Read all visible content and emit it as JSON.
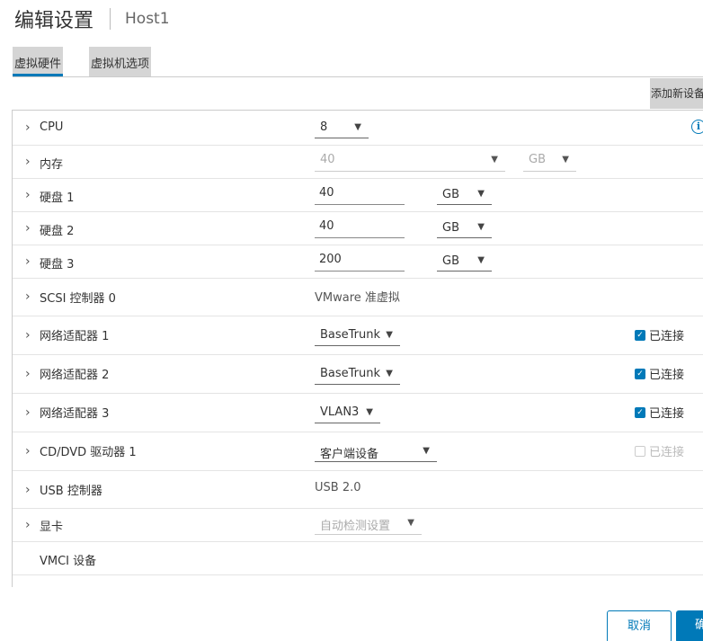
{
  "header": {
    "title": "编辑设置",
    "host": "Host1"
  },
  "tabs": [
    {
      "label": "虚拟硬件",
      "active": true
    },
    {
      "label": "虚拟机选项",
      "active": false
    }
  ],
  "toolbar": {
    "add_device_label": "添加新设备"
  },
  "rows": {
    "cpu": {
      "label": "CPU",
      "value": "8"
    },
    "memory": {
      "label": "内存",
      "value": "40",
      "unit": "GB"
    },
    "disk1": {
      "label": "硬盘 1",
      "value": "40",
      "unit": "GB"
    },
    "disk2": {
      "label": "硬盘 2",
      "value": "40",
      "unit": "GB"
    },
    "disk3": {
      "label": "硬盘 3",
      "value": "200",
      "unit": "GB"
    },
    "scsi": {
      "label": "SCSI 控制器 0",
      "value": "VMware 准虚拟"
    },
    "net1": {
      "label": "网络适配器 1",
      "value": "BaseTrunk",
      "connected_label": "已连接",
      "connected": true
    },
    "net2": {
      "label": "网络适配器 2",
      "value": "BaseTrunk",
      "connected_label": "已连接",
      "connected": true
    },
    "net3": {
      "label": "网络适配器 3",
      "value": "VLAN3",
      "connected_label": "已连接",
      "connected": true
    },
    "cddvd": {
      "label": "CD/DVD 驱动器 1",
      "value": "客户端设备",
      "connected_label": "已连接",
      "connected": false
    },
    "usb": {
      "label": "USB 控制器",
      "value": "USB 2.0"
    },
    "video": {
      "label": "显卡",
      "value": "自动检测设置"
    },
    "vmci": {
      "label": "VMCI 设备"
    }
  },
  "footer": {
    "cancel_label": "取消",
    "ok_label": "确定"
  },
  "colors": {
    "accent": "#0079b8",
    "tab_bg": "#d5d5d5"
  }
}
